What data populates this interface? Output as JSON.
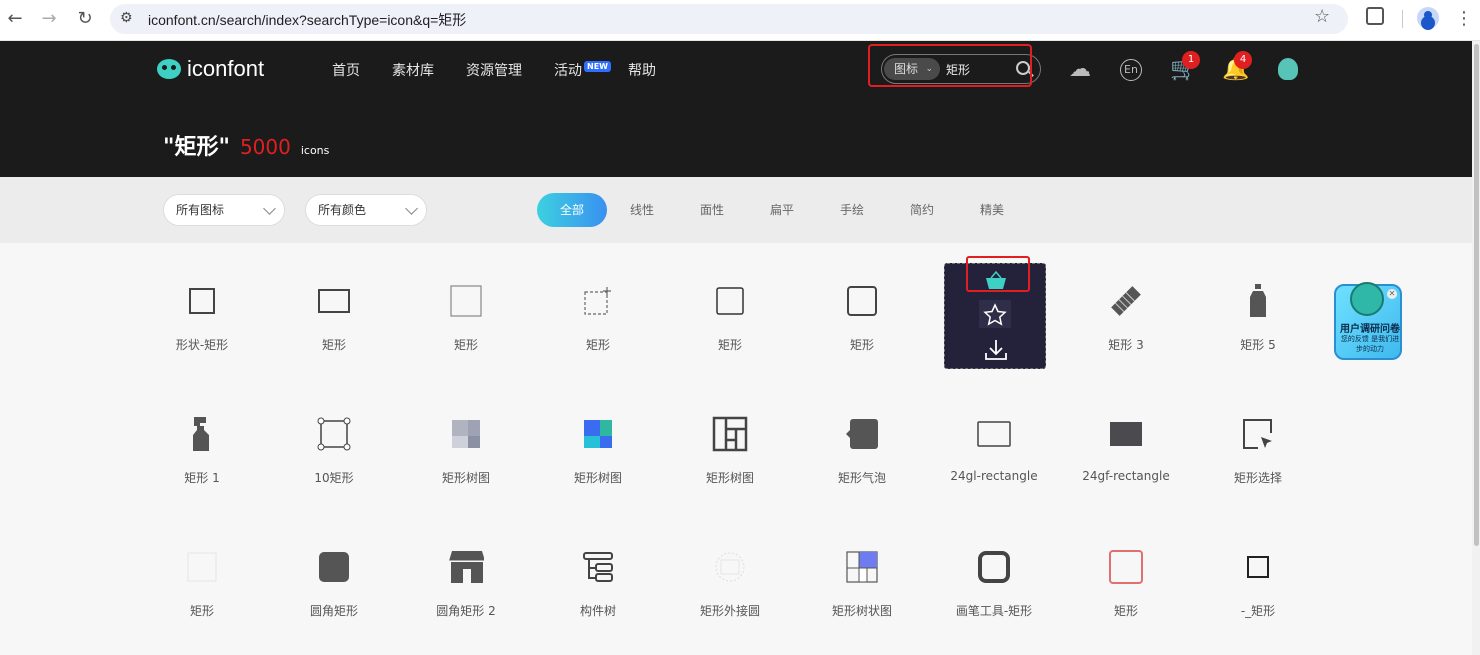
{
  "browser": {
    "url": "iconfont.cn/search/index?searchType=icon&q=矩形"
  },
  "header": {
    "logo_text": "iconfont",
    "nav": [
      {
        "label": "首页"
      },
      {
        "label": "素材库"
      },
      {
        "label": "资源管理"
      },
      {
        "label": "活动",
        "badge": "NEW"
      },
      {
        "label": "帮助"
      }
    ],
    "search": {
      "type": "图标",
      "value": "矩形"
    },
    "en_label": "En",
    "cart_count": "1",
    "notify_count": "4"
  },
  "result": {
    "query": "\"矩形\"",
    "count": "5000",
    "unit": "icons"
  },
  "filters": {
    "icon_select": "所有图标",
    "color_select": "所有颜色",
    "tabs": [
      "全部",
      "线性",
      "面性",
      "扁平",
      "手绘",
      "简约",
      "精美"
    ],
    "active_tab": "全部"
  },
  "icons": [
    {
      "name": "形状-矩形",
      "icon": "square-outline-icon"
    },
    {
      "name": "矩形",
      "icon": "rectangle-outline-icon"
    },
    {
      "name": "矩形",
      "icon": "square-light-icon"
    },
    {
      "name": "矩形",
      "icon": "dashed-square-plus-icon"
    },
    {
      "name": "矩形",
      "icon": "square-thin-icon"
    },
    {
      "name": "矩形",
      "icon": "rounded-square-icon"
    },
    {
      "name": "",
      "icon": "hovered-card"
    },
    {
      "name": "矩形 3",
      "icon": "diagonal-bar-icon"
    },
    {
      "name": "矩形 5",
      "icon": "bottle-icon"
    },
    {
      "name": "矩形 1",
      "icon": "spray-bottle-icon"
    },
    {
      "name": "10矩形",
      "icon": "rectangle-handles-icon"
    },
    {
      "name": "矩形树图",
      "icon": "treemap-gray-icon"
    },
    {
      "name": "矩形树图",
      "icon": "treemap-color-icon"
    },
    {
      "name": "矩形树图",
      "icon": "treemap-outline-icon"
    },
    {
      "name": "矩形气泡",
      "icon": "rect-bubble-icon"
    },
    {
      "name": "24gl-rectangle",
      "icon": "rectangle-line-icon"
    },
    {
      "name": "24gf-rectangle",
      "icon": "rectangle-filled-icon"
    },
    {
      "name": "矩形选择",
      "icon": "rect-select-icon"
    },
    {
      "name": "矩形",
      "icon": "faint-square-icon"
    },
    {
      "name": "圆角矩形",
      "icon": "rounded-filled-icon"
    },
    {
      "name": "圆角矩形 2",
      "icon": "shop-icon"
    },
    {
      "name": "构件树",
      "icon": "component-tree-icon"
    },
    {
      "name": "矩形外接圆",
      "icon": "circumcircle-icon"
    },
    {
      "name": "矩形树状图",
      "icon": "treemap-blue-icon"
    },
    {
      "name": "画笔工具-矩形",
      "icon": "thick-rounded-square-icon"
    },
    {
      "name": "矩形",
      "icon": "red-rounded-square-icon"
    },
    {
      "name": "-_矩形",
      "icon": "small-square-icon"
    }
  ],
  "survey": {
    "title": "用户调研问卷",
    "subtitle": "您的反馈 是我们进步的动力"
  },
  "colors": {
    "header_bg": "#1b1b1c",
    "accent_red": "#e02020",
    "tab_gradient_start": "#3cd0e0",
    "tab_gradient_end": "#3a90f0"
  }
}
